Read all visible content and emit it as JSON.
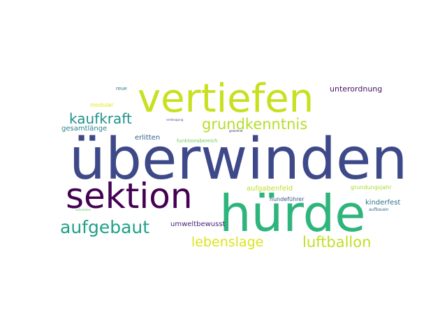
{
  "word_cloud": {
    "words": [
      {
        "text": "überwinden",
        "color": "#3e4989"
      },
      {
        "text": "vertiefen",
        "color": "#c8e020"
      },
      {
        "text": "hürde",
        "color": "#2fb47c"
      },
      {
        "text": "sektion",
        "color": "#440154"
      },
      {
        "text": "grundkenntnis",
        "color": "#b5de2b"
      },
      {
        "text": "kaufkraft",
        "color": "#21918c"
      },
      {
        "text": "aufgebaut",
        "color": "#1fa187"
      },
      {
        "text": "lebenslage",
        "color": "#dde318"
      },
      {
        "text": "luftballon",
        "color": "#c2df23"
      },
      {
        "text": "unterordnung",
        "color": "#471063"
      },
      {
        "text": "umweltbewusst",
        "color": "#482475"
      },
      {
        "text": "aufgabenfeld",
        "color": "#bddf26"
      },
      {
        "text": "kinderfest",
        "color": "#2c728e"
      },
      {
        "text": "gesamtlänge",
        "color": "#25838e"
      },
      {
        "text": "erlitten",
        "color": "#355f8d"
      },
      {
        "text": "modular",
        "color": "#e5e419"
      },
      {
        "text": "funktionsbereich",
        "color": "#6ccd5a"
      },
      {
        "text": "grundungsjahr",
        "color": "#a8db34"
      },
      {
        "text": "hundeführer",
        "color": "#3b528b"
      },
      {
        "text": "reue",
        "color": "#2c728e"
      },
      {
        "text": "aufbauen",
        "color": "#31688e"
      },
      {
        "text": "verbeugung",
        "color": "#3b528b"
      },
      {
        "text": "gewidmet",
        "color": "#482878"
      },
      {
        "text": "aufzuteilen",
        "color": "#5ec962"
      }
    ]
  }
}
